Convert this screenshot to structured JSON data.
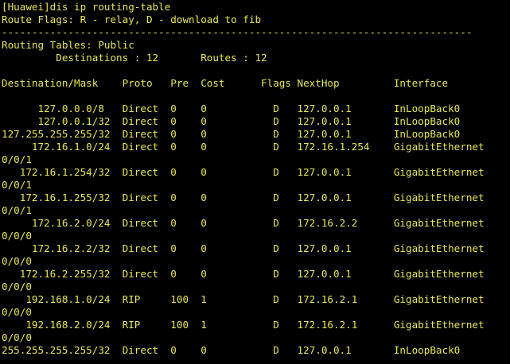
{
  "terminal": {
    "colors": {
      "background": "#000000",
      "text": "#e8e84a"
    },
    "command": "[Huawei]dis ip routing-table",
    "flags_legend": "Route Flags: R - relay, D - download to fib",
    "separator": "------------------------------------------------------------------------------",
    "table_title": "Routing Tables: Public",
    "summary": "         Destinations : 12       Routes : 12",
    "header": "Destination/Mask    Proto   Pre  Cost      Flags NextHop         Interface",
    "rows": [
      "      127.0.0.0/8   Direct  0    0           D   127.0.0.1       InLoopBack0",
      "      127.0.0.1/32  Direct  0    0           D   127.0.0.1       InLoopBack0",
      "127.255.255.255/32  Direct  0    0           D   127.0.0.1       InLoopBack0",
      "     172.16.1.0/24  Direct  0    0           D   172.16.1.254    GigabitEthernet",
      "0/0/1",
      "   172.16.1.254/32  Direct  0    0           D   127.0.0.1       GigabitEthernet",
      "0/0/1",
      "   172.16.1.255/32  Direct  0    0           D   127.0.0.1       GigabitEthernet",
      "0/0/1",
      "     172.16.2.0/24  Direct  0    0           D   172.16.2.2      GigabitEthernet",
      "0/0/0",
      "     172.16.2.2/32  Direct  0    0           D   127.0.0.1       GigabitEthernet",
      "0/0/0",
      "   172.16.2.255/32  Direct  0    0           D   127.0.0.1       GigabitEthernet",
      "0/0/0",
      "    192.168.1.0/24  RIP     100  1           D   172.16.2.1      GigabitEthernet",
      "0/0/0",
      "    192.168.2.0/24  RIP     100  1           D   172.16.2.1      GigabitEthernet",
      "0/0/0",
      "255.255.255.255/32  Direct  0    0           D   127.0.0.1       InLoopBack0"
    ]
  }
}
